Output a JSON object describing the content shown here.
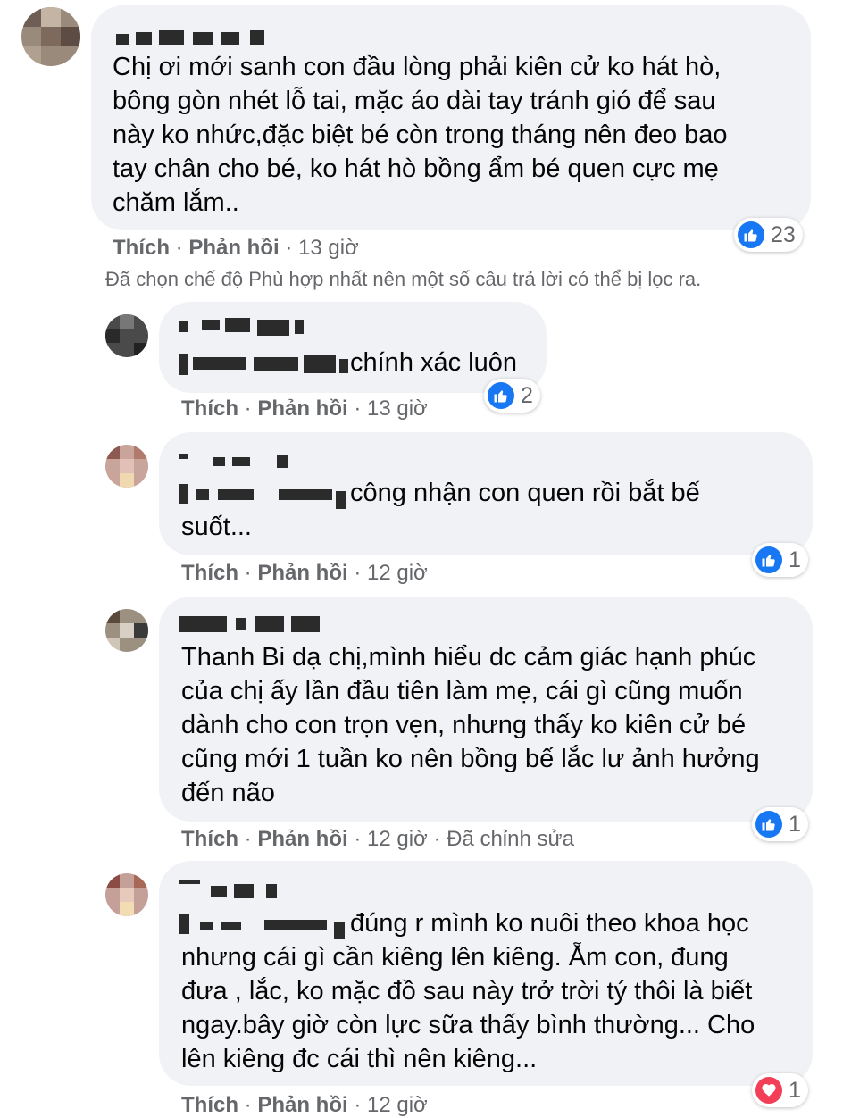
{
  "comments": [
    {
      "text_lines": [
        "Chị ơi mới sanh con đầu lòng phải kiên cử ko hát hò,",
        "bông gòn nhét lỗ tai, mặc áo dài tay tránh gió để sau",
        "này ko nhức,đặc biệt bé còn trong tháng nên đeo bao",
        "tay chân cho bé, ko hát hò bồng ẩm bé quen cực mẹ",
        "chăm lắm.."
      ],
      "like_label": "Thích",
      "reply_label": "Phản hồi",
      "time": "13 giờ",
      "reaction": {
        "icon": "like-icon",
        "count": "23"
      }
    }
  ],
  "filter_notice": "Đã chọn chế độ Phù hợp nhất nên một số câu trả lời có thể bị lọc ra.",
  "replies": [
    {
      "text_lines": [
        "chính xác luôn"
      ],
      "like_label": "Thích",
      "reply_label": "Phản hồi",
      "time": "13 giờ",
      "reaction": {
        "icon": "like-icon",
        "count": "2"
      }
    },
    {
      "text_lines": [
        "công nhận con quen rồi bắt bế",
        "suốt..."
      ],
      "like_label": "Thích",
      "reply_label": "Phản hồi",
      "time": "12 giờ",
      "reaction": {
        "icon": "like-icon",
        "count": "1"
      }
    },
    {
      "text_lines": [
        "Thanh Bi dạ chị,mình hiểu dc cảm giác hạnh phúc",
        "của chị ấy lần đầu tiên làm mẹ, cái gì cũng muốn",
        "dành cho con trọn vẹn, nhưng thấy ko kiên cử bé",
        "cũng mới 1 tuần ko nên bồng bế lắc lư ảnh hưởng",
        "đến não"
      ],
      "like_label": "Thích",
      "reply_label": "Phản hồi",
      "time": "12 giờ",
      "edited": "Đã chỉnh sửa",
      "reaction": {
        "icon": "like-icon",
        "count": "1"
      }
    },
    {
      "text_lines": [
        "đúng r mình ko nuôi theo khoa học",
        "nhưng cái gì cần kiêng lên kiêng. Ẵm con, đung",
        "đưa , lắc, ko mặc đồ sau này trở trời tý thôi là biết",
        "ngay.bây giờ còn lực sữa thấy bình thường... Cho",
        "lên kiêng đc cái thì nên kiêng..."
      ],
      "like_label": "Thích",
      "reply_label": "Phản hồi",
      "time": "12 giờ",
      "reaction": {
        "icon": "love-icon",
        "count": "1"
      }
    }
  ]
}
